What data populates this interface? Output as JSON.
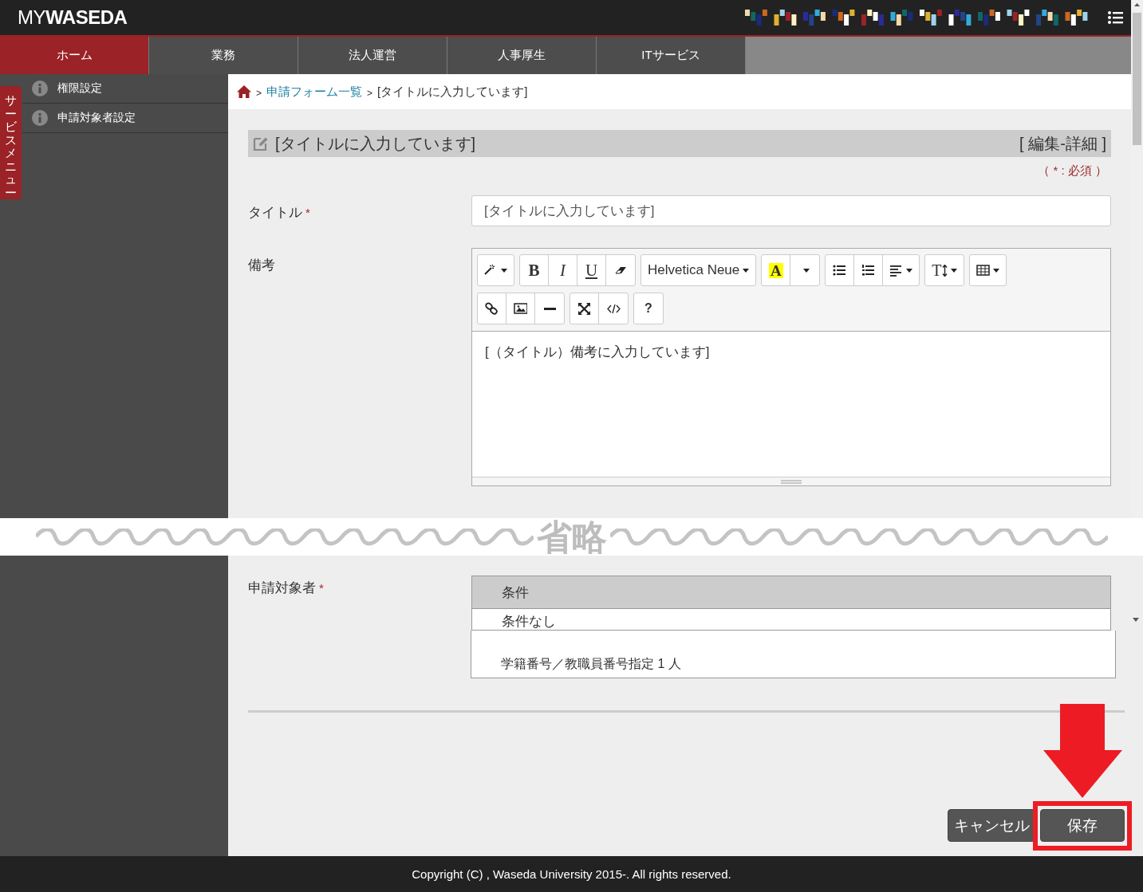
{
  "header": {
    "logo_light": "MY",
    "logo_bold": "WASEDA"
  },
  "nav_tabs": [
    {
      "label": "ホーム",
      "selected": true
    },
    {
      "label": "業務",
      "selected": false
    },
    {
      "label": "法人運営",
      "selected": false
    },
    {
      "label": "人事厚生",
      "selected": false
    },
    {
      "label": "ITサービス",
      "selected": false
    }
  ],
  "sidebar": {
    "service_menu_label": "サービスメニュー",
    "items": [
      {
        "label": "権限設定"
      },
      {
        "label": "申請対象者設定"
      }
    ]
  },
  "breadcrumb": [
    {
      "separator": ">",
      "label": "申請フォーム一覧",
      "kind": "link"
    },
    {
      "separator": ">",
      "label": "[タイトルに入力しています]",
      "kind": "current"
    }
  ],
  "form_header": {
    "title": "[タイトルに入力しています]",
    "mode": "[ 編集-詳細 ]"
  },
  "required_note": "（ * : 必須 ）",
  "title_field": {
    "label": "タイトル",
    "required_mark": "*",
    "value": "[タイトルに入力しています]"
  },
  "notes_field": {
    "label": "備考",
    "content": "[（タイトル）備考に入力しています]",
    "toolbar": [
      [
        [
          {
            "kind": "magic",
            "dropdown": true
          }
        ],
        [
          {
            "kind": "bold",
            "label": "B",
            "dropdown": false
          },
          {
            "kind": "italic",
            "label": "I",
            "dropdown": false
          },
          {
            "kind": "underline",
            "label": "U",
            "dropdown": false
          },
          {
            "kind": "eraser",
            "dropdown": false
          }
        ],
        [
          {
            "kind": "font",
            "label": "Helvetica Neue",
            "dropdown": true
          }
        ],
        [
          {
            "kind": "color",
            "label": "A",
            "dropdown": false
          },
          {
            "kind": "caret",
            "dropdown": true
          }
        ],
        [
          {
            "kind": "unordered-list",
            "dropdown": false
          },
          {
            "kind": "ordered-list",
            "dropdown": false
          },
          {
            "kind": "align",
            "dropdown": true
          }
        ],
        [
          {
            "kind": "text-height",
            "label": "T",
            "dropdown": true
          }
        ],
        [
          {
            "kind": "table",
            "dropdown": true
          }
        ]
      ],
      [
        [
          {
            "kind": "link",
            "dropdown": false
          },
          {
            "kind": "picture",
            "dropdown": false
          },
          {
            "kind": "rule",
            "dropdown": false
          }
        ],
        [
          {
            "kind": "fullscreen",
            "dropdown": false
          },
          {
            "kind": "code",
            "dropdown": false
          }
        ],
        [
          {
            "kind": "help",
            "label": "?",
            "dropdown": false
          }
        ]
      ]
    ]
  },
  "omission_label": "省略",
  "applicants_field": {
    "label": "申請対象者",
    "required_mark": "*",
    "column": "条件",
    "rows": [
      "条件なし",
      "学籍番号／教職員番号指定 1 人"
    ]
  },
  "buttons": [
    {
      "label": "キャンセル",
      "kind": "cancel",
      "highlighted": false
    },
    {
      "label": "保存",
      "kind": "save",
      "highlighted": true
    }
  ],
  "footer": "Copyright (C) , Waseda University 2015-. All rights reserved."
}
